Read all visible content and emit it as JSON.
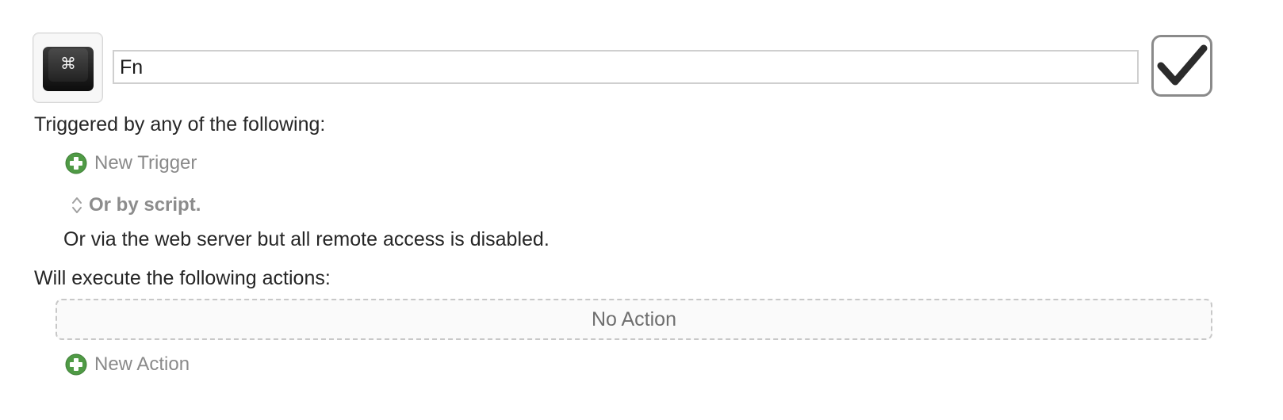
{
  "macro": {
    "name": "Fn",
    "icon_name": "command-keycap-icon",
    "enabled": true
  },
  "triggers": {
    "heading": "Triggered by any of the following:",
    "new_trigger_label": "New Trigger",
    "script_label": "Or by script.",
    "web_server_note": "Or via the web server but all remote access is disabled."
  },
  "actions": {
    "heading": "Will execute the following actions:",
    "empty_label": "No Action",
    "new_action_label": "New Action"
  },
  "colors": {
    "add_green": "#4f9a45",
    "checkmark": "#2b2b2b"
  }
}
